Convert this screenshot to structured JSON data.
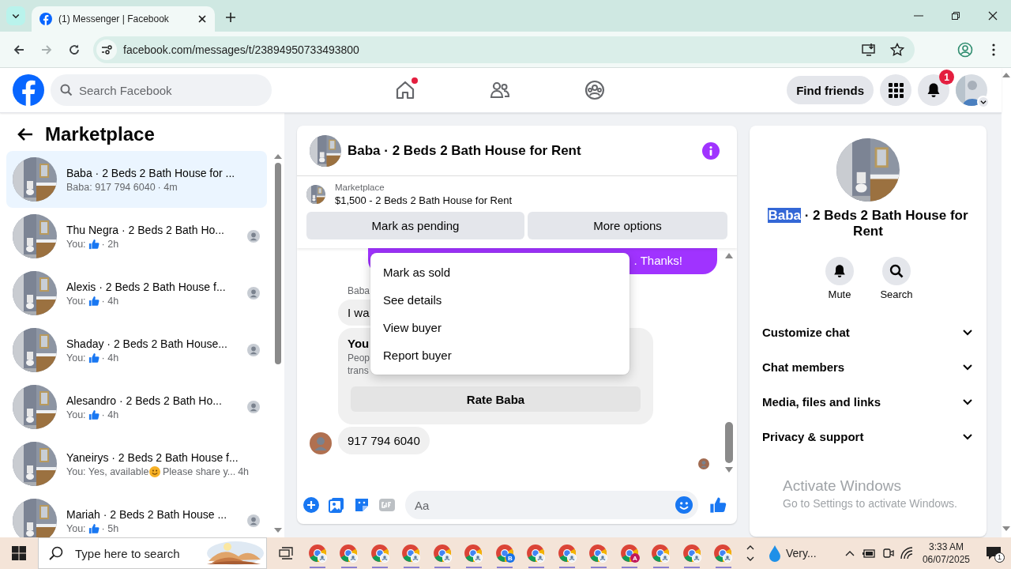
{
  "browser": {
    "tab": {
      "title": "(1) Messenger | Facebook"
    },
    "url": "facebook.com/messages/t/23894950733493800"
  },
  "topbar": {
    "search": {
      "placeholder": "Search Facebook"
    },
    "nav": [
      {
        "kind": "home",
        "dot": true
      },
      {
        "kind": "friends",
        "dot": false
      },
      {
        "kind": "groups",
        "dot": false
      }
    ],
    "find_friends": "Find friends",
    "notifications_badge": "1"
  },
  "chat_list": {
    "title": "Marketplace",
    "chats": [
      {
        "title": "Baba · 2 Beds 2 Bath House for ...",
        "kind": "text",
        "preview": "Baba: 917 794 6040",
        "time": "· 4m",
        "selected": true,
        "seen": false
      },
      {
        "title": "Thu Negra · 2 Beds 2 Bath Ho...",
        "kind": "like",
        "preview": "You:",
        "time": "· 2h",
        "selected": false,
        "seen": true
      },
      {
        "title": "Alexis · 2 Beds 2 Bath House f...",
        "kind": "like",
        "preview": "You:",
        "time": "· 4h",
        "selected": false,
        "seen": true
      },
      {
        "title": "Shaday · 2 Beds 2 Bath House...",
        "kind": "like",
        "preview": "You:",
        "time": "· 4h",
        "selected": false,
        "seen": true
      },
      {
        "title": "Alesandro · 2 Beds 2 Bath Ho...",
        "kind": "like",
        "preview": "You:",
        "time": "· 4h",
        "selected": false,
        "seen": true
      },
      {
        "title": "Yaneirys · 2 Beds 2 Bath House f...",
        "kind": "emoji",
        "preview": "You: Yes, available",
        "preview_rest": "Please share y...",
        "time": "4h",
        "selected": false,
        "seen": false
      },
      {
        "title": "Mariah · 2 Beds 2 Bath House ...",
        "kind": "like",
        "preview": "You:",
        "time": "· 5h",
        "selected": false,
        "seen": true
      }
    ]
  },
  "chat": {
    "title": "Baba · 2 Beds 2 Bath House for Rent",
    "listing": {
      "label": "Marketplace",
      "text": "$1,500 - 2 Beds 2 Bath House for Rent"
    },
    "actions": [
      "Mark as pending",
      "More options"
    ],
    "messages": [
      {
        "kind": "outgoing",
        "text": ". Thanks!"
      },
      {
        "kind": "sender",
        "text": "Baba"
      },
      {
        "kind": "incoming",
        "text": "I wa"
      },
      {
        "kind": "card",
        "title": "You",
        "lines": [
          "Peop",
          "trans"
        ],
        "button": "Rate Baba"
      },
      {
        "kind": "incoming_avatar",
        "text": "917 794 6040"
      },
      {
        "kind": "seen"
      }
    ],
    "menu": [
      "Mark as sold",
      "See details",
      "View buyer",
      "Report buyer"
    ],
    "composer": {
      "placeholder": "Aa"
    }
  },
  "info": {
    "title_selected": "Baba",
    "title_rest": " · 2 Beds 2 Bath House for Rent",
    "actions": [
      {
        "kind": "mute",
        "label": "Mute"
      },
      {
        "kind": "search",
        "label": "Search"
      }
    ],
    "sections": [
      {
        "label": "Customize chat",
        "expanded": false
      },
      {
        "label": "Chat members",
        "expanded": false
      },
      {
        "label": "Media, files and links",
        "expanded": false
      },
      {
        "label": "Privacy & support",
        "expanded": false
      }
    ]
  },
  "os_notice": {
    "title": "Activate Windows",
    "text": "Go to Settings to activate Windows."
  },
  "taskbar": {
    "search_placeholder": "Type here to search",
    "apps": [
      {
        "kind": "profile"
      },
      {
        "kind": "profile"
      },
      {
        "kind": "profile"
      },
      {
        "kind": "profile"
      },
      {
        "kind": "profile"
      },
      {
        "kind": "profile"
      },
      {
        "kind": "letter",
        "letter": "B",
        "color": "#1a73e8"
      },
      {
        "kind": "profile"
      },
      {
        "kind": "profile"
      },
      {
        "kind": "profile"
      },
      {
        "kind": "letter",
        "letter": "A",
        "color": "#c2185b"
      },
      {
        "kind": "profile"
      },
      {
        "kind": "profile"
      },
      {
        "kind": "profile"
      }
    ],
    "weather": "Very...",
    "time": "3:33 AM",
    "date": "06/07/2025",
    "notifications": "1"
  }
}
